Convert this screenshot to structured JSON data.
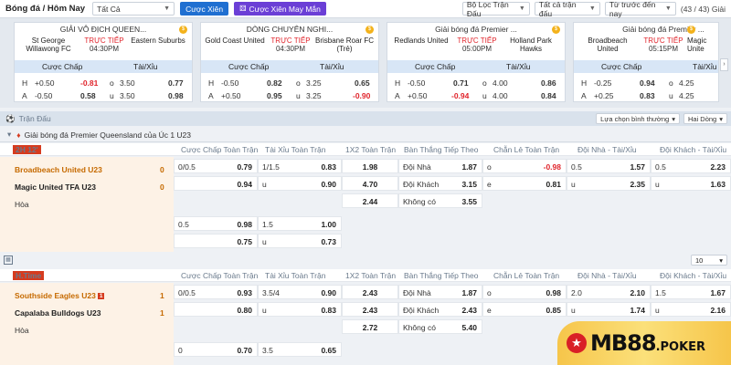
{
  "topbar": {
    "title": "Bóng đá / Hôm Nay",
    "filter_all": "Tất Cả",
    "btn_cuoc_xien": "Cược Xiên",
    "btn_may_man": "Cược Xiên May Mắn",
    "btn_may_man_icon": "dice-icon",
    "filter_league": "Bộ Lọc Trận Đấu",
    "filter_matches": "Tất cả trận đấu",
    "sort": "Từ trước đến nay",
    "count": "(43 / 43) Giải"
  },
  "cards": [
    {
      "league": "GIẢI VÔ ĐỊCH QUEEN...",
      "home": "St George Willawong FC",
      "away": "Eastern Suburbs",
      "live": "TRỰC TIẾP",
      "time": "04:30PM",
      "h_label": "Cược Chấp",
      "t_label": "Tài/Xỉu",
      "r1": {
        "hl": "H",
        "hv": "+0.50",
        "ho": "-0.81",
        "tl": "o",
        "tv": "3.50",
        "to": "0.77"
      },
      "r2": {
        "hl": "A",
        "hv": "-0.50",
        "ho": "0.58",
        "tl": "u",
        "tv": "3.50",
        "to": "0.98"
      }
    },
    {
      "league": "DÒNG CHUYÊN NGHI...",
      "home": "Gold Coast United",
      "away": "Brisbane Roar FC (Trẻ)",
      "live": "TRỰC TIẾP",
      "time": "04:30PM",
      "h_label": "Cược Chấp",
      "t_label": "Tài/Xỉu",
      "r1": {
        "hl": "H",
        "hv": "-0.50",
        "ho": "0.82",
        "tl": "o",
        "tv": "3.25",
        "to": "0.65"
      },
      "r2": {
        "hl": "A",
        "hv": "+0.50",
        "ho": "0.95",
        "tl": "u",
        "tv": "3.25",
        "to": "-0.90"
      }
    },
    {
      "league": "Giải bóng đá Premier ...",
      "home": "Redlands United",
      "away": "Holland Park Hawks",
      "live": "TRỰC TIẾP",
      "time": "05:00PM",
      "h_label": "Cược Chấp",
      "t_label": "Tài/Xỉu",
      "r1": {
        "hl": "H",
        "hv": "-0.50",
        "ho": "0.71",
        "tl": "o",
        "tv": "4.00",
        "to": "0.86"
      },
      "r2": {
        "hl": "A",
        "hv": "+0.50",
        "ho": "-0.94",
        "tl": "u",
        "tv": "4.00",
        "to": "0.84"
      }
    },
    {
      "league": "Giải bóng đá Premier ...",
      "home": "Broadbeach United",
      "away": "Magic Unite",
      "live": "TRỰC TIẾP",
      "time": "05:15PM",
      "h_label": "Cược Chấp",
      "t_label": "Tài/Xỉu",
      "r1": {
        "hl": "H",
        "hv": "-0.25",
        "ho": "0.94",
        "tl": "o",
        "tv": "4.25",
        "to": ""
      },
      "r2": {
        "hl": "A",
        "hv": "+0.25",
        "ho": "0.83",
        "tl": "u",
        "tv": "4.25",
        "to": ""
      }
    }
  ],
  "section": {
    "title": "Trận Đấu",
    "sort_label": "Lựa chọn bình thường",
    "view_label": "Hai Dòng"
  },
  "league": {
    "name": "Giải bóng đá Premier Queensland của Úc 1 U23"
  },
  "headers": [
    "Cược Chấp Toàn Trận",
    "Tài Xỉu Toàn Trận",
    "1X2 Toàn Trận",
    "Bàn Thắng Tiếp Theo",
    "Chẵn Lẻ Toàn Trận",
    "Đội Nhà - Tài/Xỉu",
    "Đội Khách - Tài/Xỉu"
  ],
  "match1": {
    "status": "2H 12'",
    "home": "Broadbeach United U23",
    "away": "Magic United TFA U23",
    "draw": "Hòa",
    "home_score": "0",
    "away_score": "0",
    "r1": [
      "0/0.5",
      "0.79",
      "1/1.5",
      "0.83",
      "1.98",
      "Đội Nhà",
      "1.87",
      "o",
      "-0.98",
      "0.5",
      "1.57",
      "0.5",
      "2.23"
    ],
    "r2": [
      "",
      "0.94",
      "u",
      "0.90",
      "4.70",
      "Đội Khách",
      "3.15",
      "e",
      "0.81",
      "u",
      "2.35",
      "u",
      "1.63"
    ],
    "r3": [
      "2.44",
      "Không có",
      "3.55"
    ],
    "r4": [
      "0.5",
      "0.98",
      "1.5",
      "1.00"
    ],
    "r5": [
      "",
      "0.75",
      "u",
      "0.73"
    ]
  },
  "pager": {
    "icon": "grid-icon",
    "per_page": "10"
  },
  "match2": {
    "status": "H.Time",
    "home": "Southside Eagles U23",
    "home_badge": "1",
    "away": "Capalaba Bulldogs U23",
    "draw": "Hòa",
    "home_score": "1",
    "away_score": "1",
    "r1": [
      "0/0.5",
      "0.93",
      "3.5/4",
      "0.90",
      "2.43",
      "Đội Nhà",
      "1.87",
      "o",
      "0.98",
      "2.0",
      "2.10",
      "1.5",
      "1.67"
    ],
    "r2": [
      "",
      "0.80",
      "u",
      "0.83",
      "2.43",
      "Đội Khách",
      "2.43",
      "e",
      "0.85",
      "u",
      "1.74",
      "u",
      "2.16"
    ],
    "r3": [
      "2.72",
      "Không có",
      "5.40"
    ],
    "r4": [
      "0",
      "0.70",
      "3.5",
      "0.65"
    ]
  },
  "logo": {
    "text": "MB88",
    "suffix": ".POKER"
  }
}
